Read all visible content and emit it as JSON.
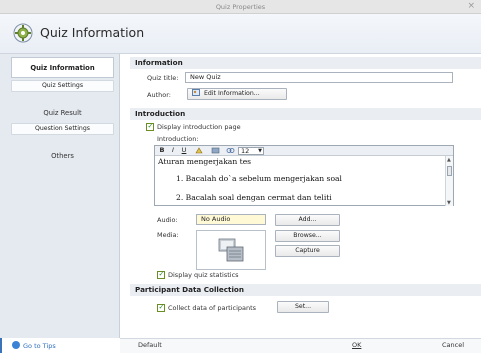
{
  "window": {
    "title": "Quiz Properties",
    "close_glyph": "×"
  },
  "header": {
    "title": "Quiz Information",
    "icon": "gear-icon"
  },
  "sidebar": {
    "items": [
      {
        "label": "Quiz Information",
        "active": true
      },
      {
        "label": "Quiz Settings"
      },
      {
        "label": "Quiz Result"
      },
      {
        "label": "Question Settings"
      },
      {
        "label": "Others"
      }
    ],
    "go_to_tips": "Go to Tips"
  },
  "information": {
    "section_title": "Information",
    "quiz_title_label": "Quiz title:",
    "quiz_title_value": "New Quiz",
    "author_label": "Author:",
    "edit_information_button": "Edit Information..."
  },
  "introduction": {
    "section_title": "Introduction",
    "display_intro_label": "Display introduction page",
    "display_intro_checked": true,
    "intro_label": "Introduction:",
    "toolbar": {
      "bold": "B",
      "italic": "I",
      "underline": "U",
      "font_size": "12"
    },
    "content_title": "Aturan mengerjakan tes",
    "content_items": [
      "1.   Bacalah do`a sebelum mengerjakan soal",
      "2.   Bacalah soal dengan cermat dan teliti"
    ],
    "audio_label": "Audio:",
    "audio_value": "No Audio",
    "add_button": "Add...",
    "media_label": "Media:",
    "browse_button": "Browse...",
    "capture_button": "Capture",
    "display_stats_label": "Display quiz statistics",
    "display_stats_checked": true
  },
  "participant": {
    "section_title": "Participant Data Collection",
    "collect_label": "Collect data of participants",
    "collect_checked": true,
    "set_button": "Set..."
  },
  "footer": {
    "default_button": "Default",
    "ok_button": "OK",
    "cancel_button": "Cancel"
  },
  "colors": {
    "accent": "#2f6fbf",
    "sidebar_bg": "#e5eaf1",
    "section_bg": "#eaeef3",
    "audio_field_bg": "#fff9d6"
  }
}
